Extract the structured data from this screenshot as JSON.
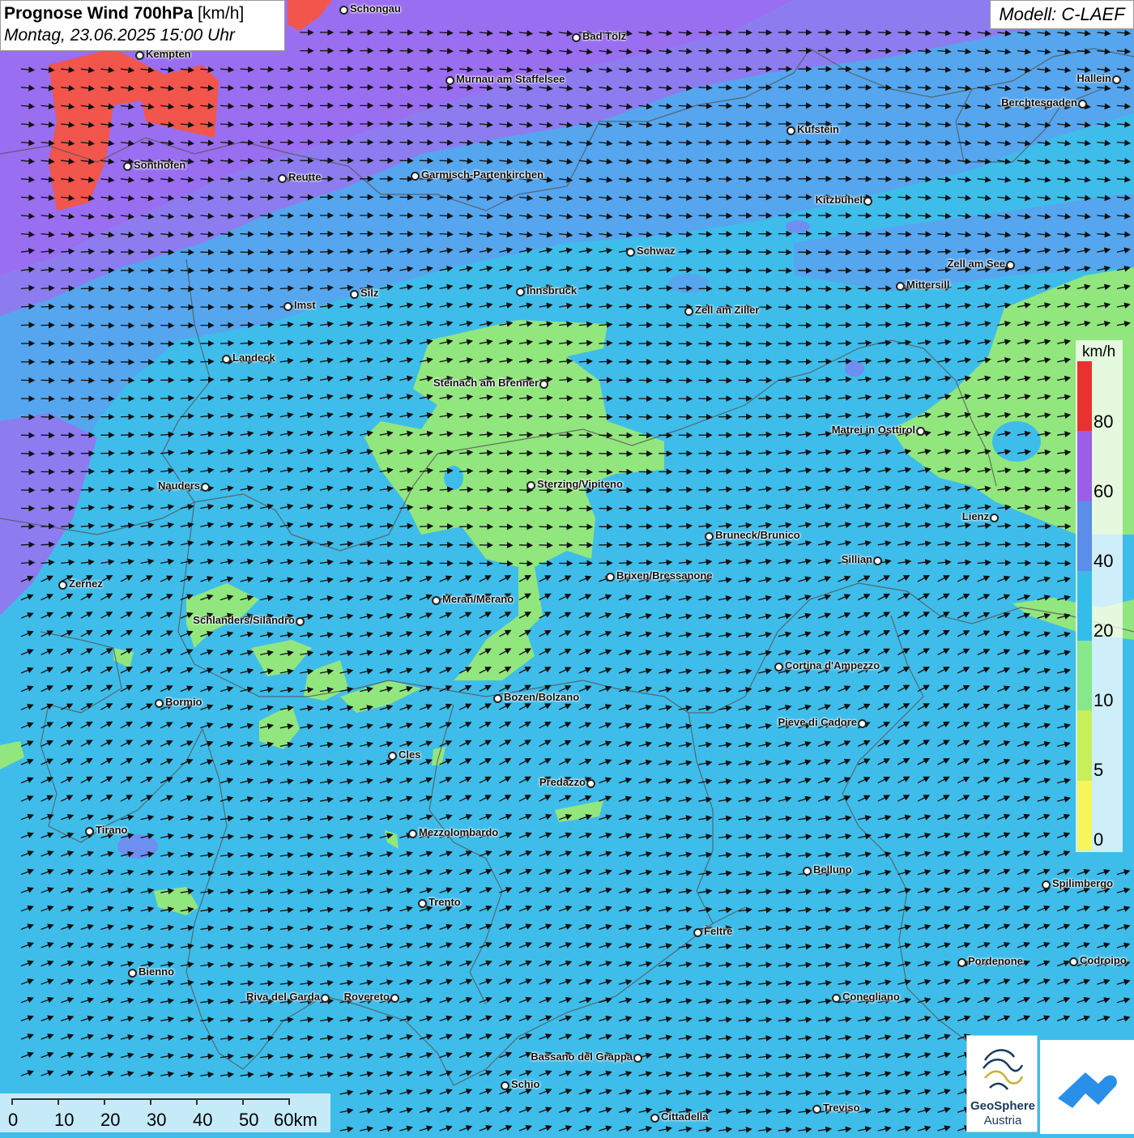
{
  "header": {
    "title_bold": "Prognose Wind 700hPa",
    "title_unit": "[km/h]",
    "datetime": "Montag, 23.06.2025 15:00 Uhr"
  },
  "model": {
    "label": "Modell: C-LAEF"
  },
  "legend": {
    "unit": "km/h",
    "ticks": [
      "80",
      "60",
      "40",
      "20",
      "10",
      "5",
      "0"
    ],
    "colors": [
      "#e8322f",
      "#9a5ee8",
      "#5b8ee8",
      "#35bdea",
      "#86e88a",
      "#c8ee5a",
      "#f7f55c"
    ]
  },
  "scale_bar": {
    "labels": [
      "0",
      "10",
      "20",
      "30",
      "40",
      "50",
      "60km"
    ]
  },
  "logos": {
    "geosphere_name": "GeoSphere",
    "geosphere_sub": "Austria",
    "geosphere_icon": "geosphere-logo-icon",
    "second_icon": "mountain-cloud-logo-icon"
  },
  "field_colors": {
    "red": "#f2554b",
    "purple": "#9a6ef0",
    "violet_blue": "#7d8ff0",
    "blue": "#52a8ee",
    "cyan": "#3fbdea",
    "green": "#92e67e"
  },
  "wind_direction": "west-southwest to east-northeast arrows",
  "cities": [
    "Schongau",
    "Bad Tölz",
    "Kempten",
    "Murnau am Staffelsee",
    "Hallein",
    "Berchtesgaden",
    "Kufstein",
    "Sonthofen",
    "Reutte",
    "Garmisch-Partenkirchen",
    "Kitzbühel",
    "Schwaz",
    "Zell am See",
    "Innsbruck",
    "Mittersill",
    "Silz",
    "Imst",
    "Zell am Ziller",
    "Landeck",
    "Steinach am Brenner",
    "Matrei in Osttirol",
    "Nauders",
    "Sterzing/Vipiteno",
    "Lienz",
    "Bruneck/Brunico",
    "Sillian",
    "Brixen/Bressanone",
    "Zernez",
    "Meran/Merano",
    "Schlanders/Silandro",
    "Cortina d'Ampezzo",
    "Bozen/Bolzano",
    "Bormio",
    "Pieve di Cadore",
    "Cles",
    "Predazzo",
    "Tirano",
    "Mezzolombardo",
    "Belluno",
    "Spilimbergo",
    "Trento",
    "Feltre",
    "Pordenone",
    "Codroipo",
    "Bienno",
    "Riva del Garda",
    "Rovereto",
    "Conegliano",
    "Bassano del Grappa",
    "Schio",
    "Treviso",
    "Cittadella"
  ]
}
